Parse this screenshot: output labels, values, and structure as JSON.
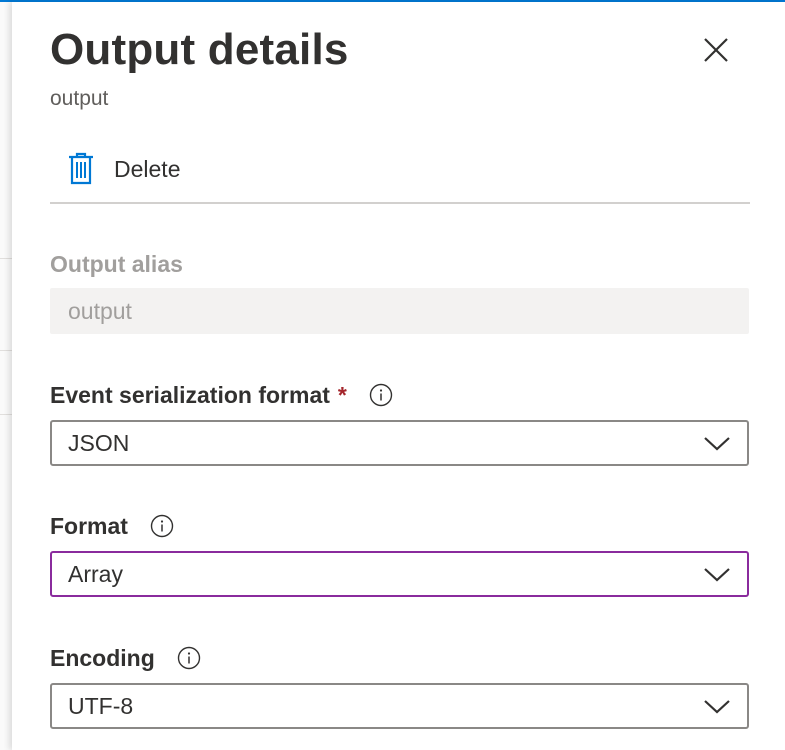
{
  "panel": {
    "title": "Output details",
    "subtitle": "output",
    "close_icon": "close-icon"
  },
  "toolbar": {
    "delete_label": "Delete",
    "delete_icon": "trash-icon"
  },
  "fields": {
    "output_alias": {
      "label": "Output alias",
      "value": "output",
      "disabled": true
    },
    "event_serialization_format": {
      "label": "Event serialization format",
      "required_mark": "*",
      "info_icon": "info-icon",
      "value": "JSON"
    },
    "format": {
      "label": "Format",
      "info_icon": "info-icon",
      "value": "Array",
      "focused": true
    },
    "encoding": {
      "label": "Encoding",
      "info_icon": "info-icon",
      "value": "UTF-8"
    }
  },
  "colors": {
    "accent": "#0078d4",
    "required": "#a4262c",
    "focus_border": "#8a2b9d",
    "disabled_text": "#a19f9d",
    "disabled_bg": "#f3f2f1"
  }
}
